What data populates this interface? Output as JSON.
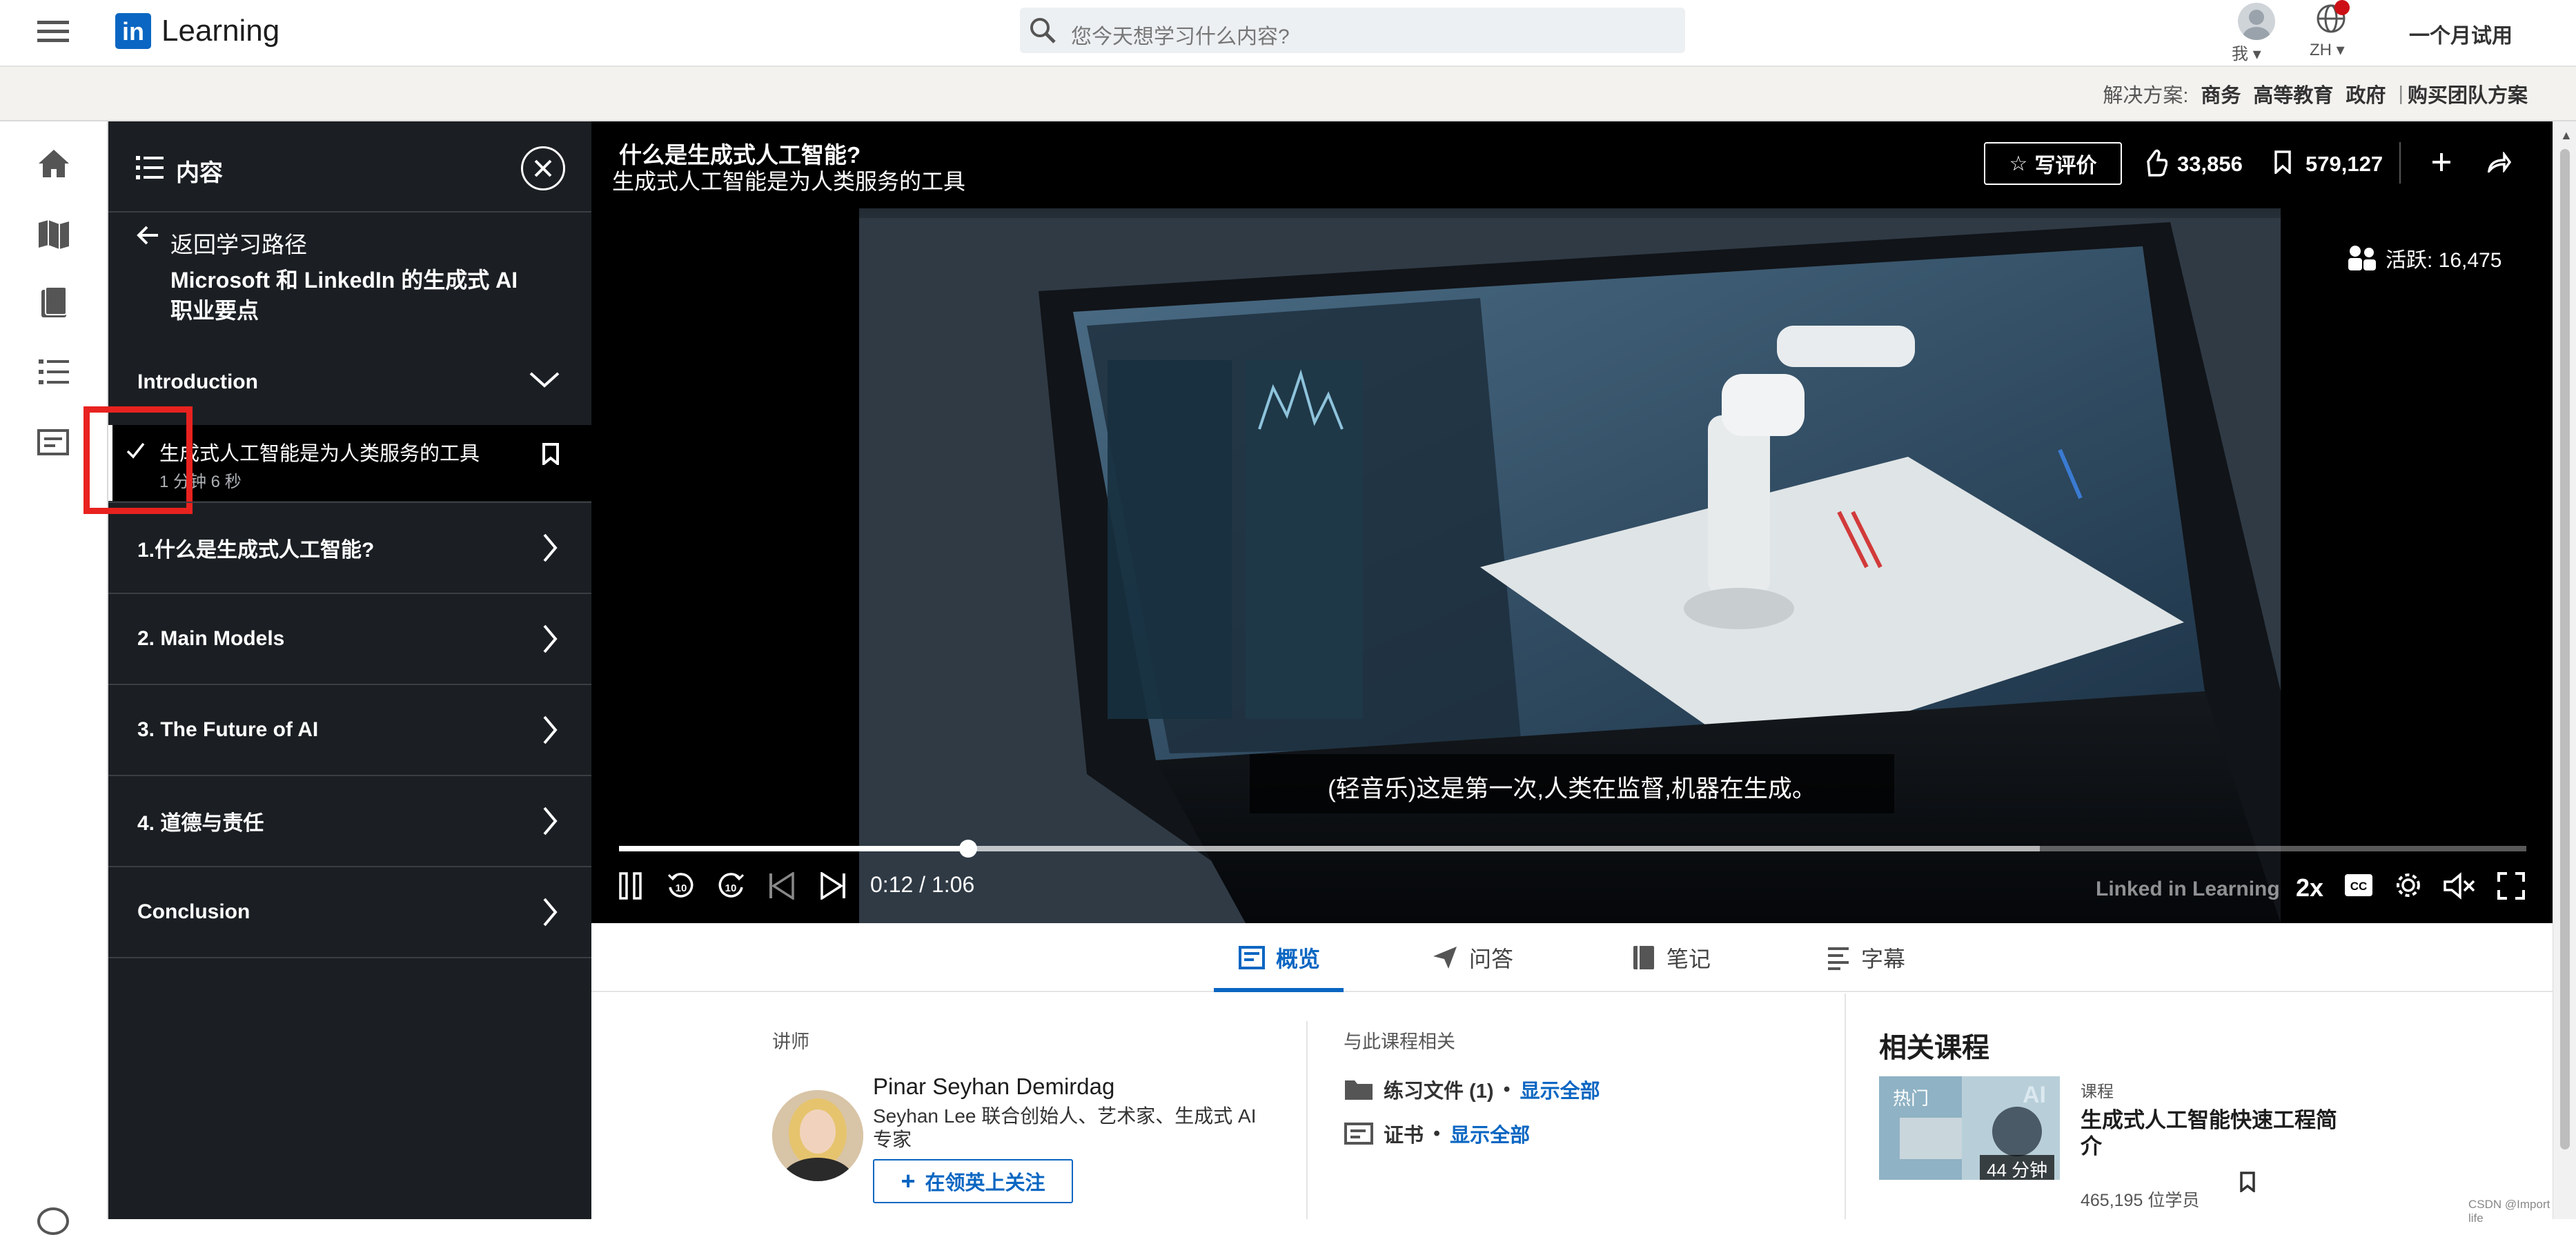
{
  "header": {
    "brand": "Learning",
    "search_placeholder": "您今天想学习什么内容?",
    "me_label": "我",
    "lang_label": "ZH",
    "trial_label": "一个月试用"
  },
  "solutions": {
    "prefix": "解决方案:",
    "items": [
      "商务",
      "高等教育",
      "政府"
    ],
    "team": "购买团队方案"
  },
  "toc": {
    "title": "内容",
    "back_label": "返回学习路径",
    "path_title_line1": "Microsoft 和 LinkedIn 的生成式 AI",
    "path_title_line2": "职业要点",
    "section": "Introduction",
    "current_item": {
      "title": "生成式人工智能是为人类服务的工具",
      "duration": "1 分钟 6 秒"
    },
    "chapters": [
      "1.什么是生成式人工智能?",
      "2. Main Models",
      "3. The Future of AI",
      "4. 道德与责任",
      "Conclusion"
    ]
  },
  "video": {
    "title": "什么是生成式人工智能?",
    "subtitle": "生成式人工智能是为人类服务的工具",
    "review_label": "写评价",
    "likes": "33,856",
    "saves": "579,127",
    "active_label": "活跃: 16,475",
    "caption": "(轻音乐)这是第一次,人类在监督,机器在生成。",
    "time": "0:12 / 1:06",
    "progress": 0.183,
    "buffered": 0.745,
    "speed": "2x",
    "watermark": "Linked in Learning"
  },
  "tabs": [
    "概览",
    "问答",
    "笔记",
    "字幕"
  ],
  "instructor": {
    "heading": "讲师",
    "name": "Pinar Seyhan Demirdag",
    "desc_line1": "Seyhan Lee 联合创始人、艺术家、生成式 AI",
    "desc_line2": "专家",
    "follow": "在领英上关注"
  },
  "related_to_course": {
    "heading": "与此课程相关",
    "exercise": "练习文件 (1)",
    "cert": "证书",
    "show_all": "显示全部",
    "dot": "•"
  },
  "related_courses": {
    "heading": "相关课程",
    "badge": "热门",
    "thumb_text": "AI",
    "duration": "44 分钟",
    "kind": "课程",
    "title_line1": "生成式人工智能快速工程简",
    "title_line2": "介",
    "learners": "465,195 位学员"
  },
  "footer_credit": "CSDN @Import life",
  "colors": {
    "accent": "#0a66c2",
    "toc_bg": "#1b1f23",
    "highlight": "#e8221f"
  }
}
